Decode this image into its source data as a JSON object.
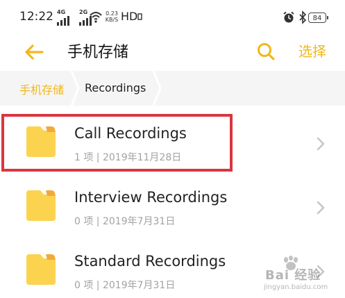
{
  "status_bar": {
    "time": "12:22",
    "signal1_tech": "4G",
    "signal2_tech": "2G",
    "net_speed_value": "0.23",
    "net_speed_unit": "KB/S",
    "hd": "HD",
    "battery": "84",
    "icons": [
      "wifi-icon",
      "alarm-icon",
      "bluetooth-icon"
    ]
  },
  "header": {
    "title": "手机存储",
    "select_label": "选择",
    "accent_color": "#f2b71a"
  },
  "breadcrumb": {
    "root": "手机存储",
    "current": "Recordings"
  },
  "items": [
    {
      "name": "Call Recordings",
      "meta": "1 项 | 2019年11月28日"
    },
    {
      "name": "Interview Recordings",
      "meta": "0 项 | 2019年7月31日"
    },
    {
      "name": "Standard Recordings",
      "meta": "0 项 | 2019年7月31日"
    }
  ],
  "highlight_color": "#d93640",
  "watermark": {
    "text": "Bai 经验",
    "sub": "jingyan.baidu.com"
  }
}
